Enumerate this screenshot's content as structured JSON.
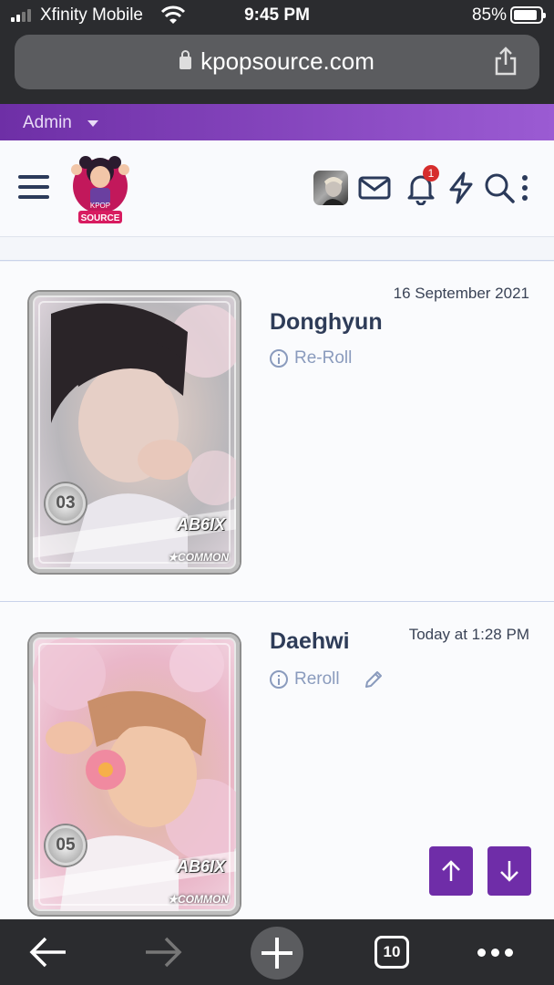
{
  "status_bar": {
    "carrier": "Xfinity Mobile",
    "time": "9:45 PM",
    "battery": "85%"
  },
  "browser": {
    "url": "kpopsource.com",
    "tabs_count": "10"
  },
  "admin_bar": {
    "label": "Admin"
  },
  "header": {
    "notification_count": "1",
    "logo_text_top": "KPOP",
    "logo_text_bottom": "SOURCE"
  },
  "items": [
    {
      "title": "Donghyun",
      "date": "16 September 2021",
      "action": "Re-Roll",
      "card_number": "03",
      "card_group": "AB6IX",
      "card_rarity": "★COMMON"
    },
    {
      "title": "Daehwi",
      "date": "Today at 1:28 PM",
      "action": "Reroll",
      "card_number": "05",
      "card_group": "AB6IX",
      "card_rarity": "★COMMON"
    }
  ],
  "colors": {
    "accent": "#6f2da8",
    "admin_bar": "#7e3fbf",
    "title": "#2e3c58",
    "muted_link": "#8a9bbd",
    "badge": "#d62d2d"
  }
}
